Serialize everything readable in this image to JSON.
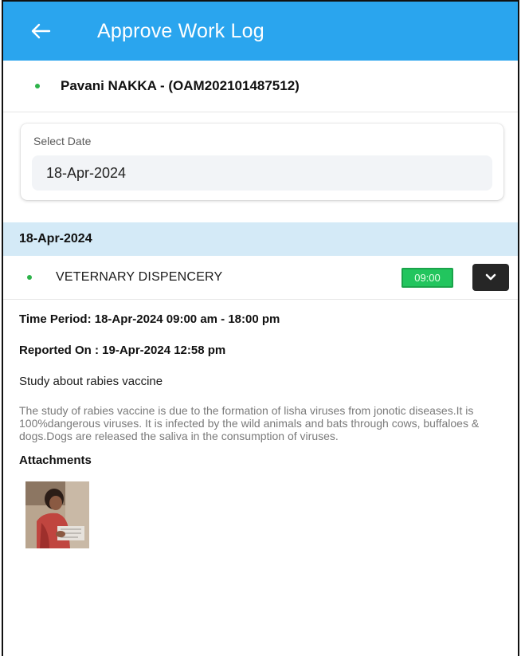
{
  "appbar": {
    "title": "Approve Work Log",
    "back_icon": "arrow-left-icon",
    "color": "#2aa5ee"
  },
  "user": {
    "name": "Pavani NAKKA - (OAM202101487512)",
    "status_color": "#2db34a"
  },
  "date_selector": {
    "label": "Select Date",
    "value": "18-Apr-2024"
  },
  "log_group": {
    "date": "18-Apr-2024",
    "entry": {
      "name": "VETERNARY DISPENCERY",
      "time": "09:00",
      "expand_icon": "chevron-down-icon",
      "badge_color": "#22c55e"
    }
  },
  "details": {
    "time_period": "Time Period: 18-Apr-2024 09:00 am - 18:00 pm",
    "reported_on": "Reported On : 19-Apr-2024 12:58 pm",
    "subject": "Study about rabies vaccine",
    "description": "The study of rabies vaccine is due to the formation of lisha viruses from jonotic diseases.It is 100%dangerous viruses. It is infected by the wild animals and bats through cows, buffaloes & dogs.Dogs are released the saliva in the consumption of viruses.",
    "attachments_title": "Attachments"
  }
}
